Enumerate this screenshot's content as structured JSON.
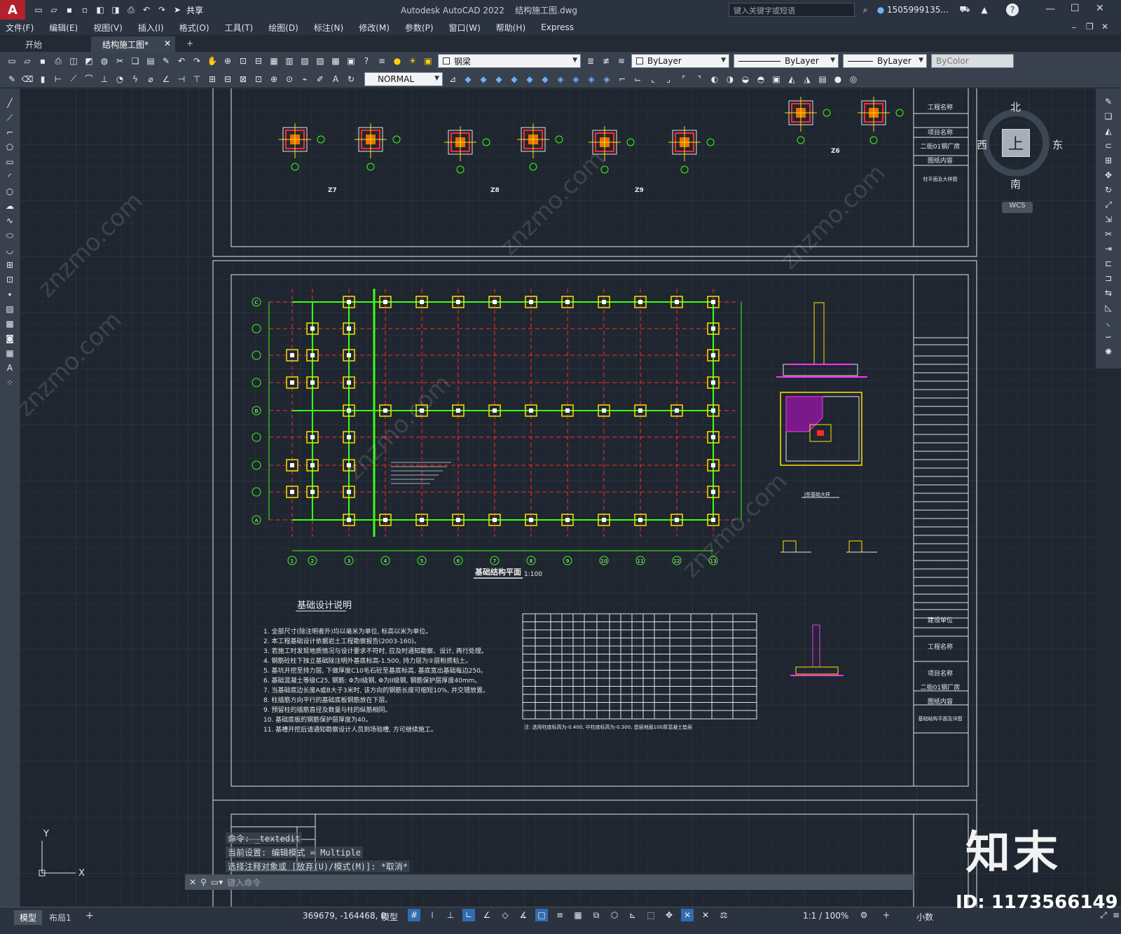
{
  "app": {
    "logo_letter": "A",
    "title": "Autodesk AutoCAD 2022    结构施工图.dwg",
    "share_label": "共享",
    "search_placeholder": "键入关键字或短语",
    "user": "1505999135...",
    "window_controls": [
      "—",
      "☐",
      "✕"
    ]
  },
  "menu": [
    "文件(F)",
    "编辑(E)",
    "视图(V)",
    "插入(I)",
    "格式(O)",
    "工具(T)",
    "绘图(D)",
    "标注(N)",
    "修改(M)",
    "参数(P)",
    "窗口(W)",
    "帮助(H)",
    "Express"
  ],
  "tabs": [
    {
      "label": "开始"
    },
    {
      "label": "结构施工图*"
    }
  ],
  "toolbar": {
    "layer_value": "钢梁",
    "color_value": "ByLayer",
    "linetype_value": "ByLayer",
    "lineweight_value": "ByLayer",
    "plotstyle_value": "ByColor",
    "dimstyle_value": "NORMAL"
  },
  "viewcube": {
    "north": "北",
    "south": "南",
    "east": "东",
    "west": "西",
    "face": "上",
    "wcs": "WCS"
  },
  "drawing": {
    "column_labels": [
      "Z7",
      "Z8",
      "Z9",
      "Z6"
    ],
    "plan_title": "基础结构平面",
    "plan_scale": "1:100",
    "notes_title": "基础设计说明",
    "notes": [
      "1. 全部尺寸(除注明者外)均以毫米为单位, 标高以米为单位。",
      "2. 本工程基础设计依据岩土工程勘察报告(2003-160)。",
      "3. 若施工时发现地质情况与设计要求不符时, 应及时通知勘察、设计, 再行处理。",
      "4. 钢筋砼柱下独立基础除注明外基底标高-1.500, 持力层为②层粉质粘土。",
      "5. 基坑开挖至持力层, 下做厚度C10毛石砼至基底标高, 基底宽出基础每边250。",
      "6. 基础混凝土等级C25, 钢筋: Φ为I级钢, Φ为II级钢, 钢筋保护层厚度40mm。",
      "7. 当基础底边长度A或B大于3米时, 该方向的钢筋长度可缩短10%, 并交错放置。",
      "8. 柱插筋方向平行的基础底板钢筋放在下层。",
      "9. 预留柱的插筋直径及数量与柱的纵筋相同。",
      "10. 基础底板的钢筋保护层厚度为40。",
      "11. 基槽开挖后请通知勘察设计人员到场验槽, 方可继续施工。"
    ],
    "table_note": "注: 选用柱底标高为-0.400, 中柱底标高为-0.300, 首层地面100厚混凝土垫层",
    "titleblock": [
      "工程名称",
      "项目名称",
      "二街01钢厂房",
      "图纸内容",
      "柱平面及大样图"
    ],
    "titleblock2": [
      "建设单位",
      "工程名称",
      "项目名称",
      "二街01钢厂房",
      "图纸内容",
      "基础结构平面及详图"
    ],
    "detail_title": "J型基础大样",
    "grid_numbers": [
      "1",
      "2",
      "3",
      "4",
      "5",
      "6",
      "7",
      "8",
      "9",
      "10",
      "11",
      "12",
      "13"
    ],
    "grid_letters": [
      "C",
      "B",
      "A"
    ]
  },
  "command": {
    "line1": "命令: _textedit",
    "line2": "当前设置: 编辑模式 = Multiple",
    "line3": "选择注释对象或 [放弃(U)/模式(M)]: *取消*",
    "input_placeholder": "键入命令"
  },
  "status": {
    "layout_tabs": [
      "模型",
      "布局1"
    ],
    "coords": "369679, -164468, 0",
    "model_label": "模型",
    "scale": "1:1 / 100%",
    "units": "小数"
  },
  "watermark": {
    "brand": "知末",
    "id": "ID: 1173566149",
    "site": "znzmo.com"
  },
  "colors": {
    "canvas": "#1f2630",
    "grid_red": "#ff2a2a",
    "grid_green": "#39ff14",
    "column_yellow": "#ffe100",
    "magenta": "#ff33ff"
  }
}
